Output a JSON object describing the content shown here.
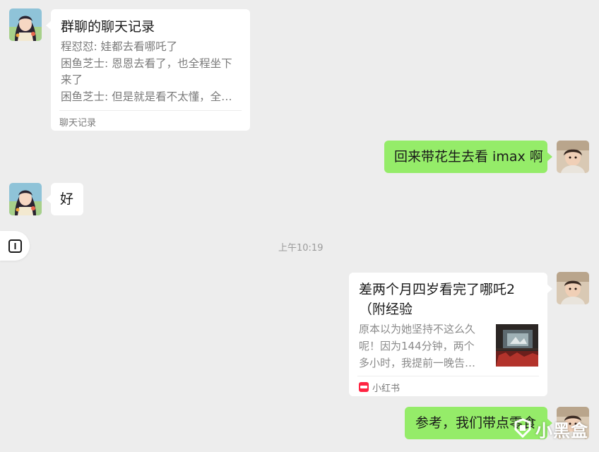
{
  "chat_record": {
    "title": "群聊的聊天记录",
    "lines": [
      "程怼怼: 娃都去看哪吒了",
      "困鱼芝士: 恩恩去看了，也全程坐下",
      "来了",
      "困鱼芝士: 但是就是看不太懂，全…"
    ],
    "footer": "聊天记录"
  },
  "messages": {
    "m1": "回来带花生去看 imax 啊",
    "m2": "好",
    "m3": "参考，我们带点零食"
  },
  "timestamp": "上午10:19",
  "link_card": {
    "title_line1": "差两个月四岁看完了哪吒2",
    "title_line2": "（附经验",
    "desc_lines": [
      "原本以为她坚持不这么久",
      "呢！因为144分钟，两个",
      "多小时，我提前一晚告…"
    ],
    "source": "小红书",
    "source_logo_text": "小红书"
  },
  "watermark": {
    "text": "小黑盒"
  },
  "icons": {
    "side_button": "sidebar-toggle-icon",
    "source_logo": "xiaohongshu-logo-icon",
    "watermark_logo": "xiaoheihe-logo-icon"
  },
  "colors": {
    "background": "#ededed",
    "bubble_self": "#95ec69",
    "bubble_other": "#ffffff",
    "xiaohongshu_red": "#ff2442"
  }
}
